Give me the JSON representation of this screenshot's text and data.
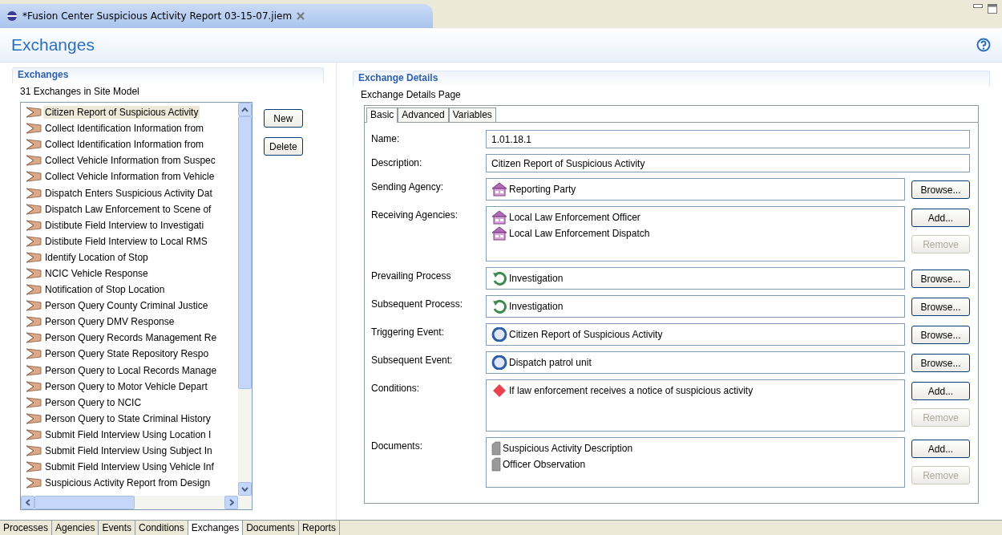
{
  "editor_tab": {
    "title": "*Fusion Center Suspicious Activity Report 03-15-07.jiem"
  },
  "page_title": "Exchanges",
  "exchanges": {
    "title": "Exchanges",
    "subtitle": "31 Exchanges in Site Model",
    "items": [
      {
        "text": "Citizen Report of Suspicious Activity",
        "selected": true
      },
      {
        "text": "Collect Identification Information from",
        "selected": false
      },
      {
        "text": "Collect Identification Information from",
        "selected": false
      },
      {
        "text": "Collect Vehicle Information from Suspec",
        "selected": false
      },
      {
        "text": "Collect Vehicle Information from Vehicle",
        "selected": false
      },
      {
        "text": "Dispatch Enters Suspicious Activity Dat",
        "selected": false
      },
      {
        "text": "Dispatch Law Enforcement to Scene of",
        "selected": false
      },
      {
        "text": "Distibute Field Interview to Investigati",
        "selected": false
      },
      {
        "text": "Distibute Field Interview to Local RMS",
        "selected": false
      },
      {
        "text": "Identify Location of Stop",
        "selected": false
      },
      {
        "text": "NCIC Vehicle Response",
        "selected": false
      },
      {
        "text": "Notification of Stop Location",
        "selected": false
      },
      {
        "text": "Person Query County Criminal Justice",
        "selected": false
      },
      {
        "text": "Person Query DMV Response",
        "selected": false
      },
      {
        "text": "Person Query Records Management Re",
        "selected": false
      },
      {
        "text": "Person Query State Repository Respo",
        "selected": false
      },
      {
        "text": "Person Query to Local Records Manage",
        "selected": false
      },
      {
        "text": "Person Query to Motor Vehicle Depart",
        "selected": false
      },
      {
        "text": "Person Query to NCIC",
        "selected": false
      },
      {
        "text": "Person Query to State Criminal History",
        "selected": false
      },
      {
        "text": "Submit Field Interview Using Location I",
        "selected": false
      },
      {
        "text": "Submit Field Interview Using Subject In",
        "selected": false
      },
      {
        "text": "Submit Field Interview Using Vehicle Inf",
        "selected": false
      },
      {
        "text": "Suspicious Activity Report from Design",
        "selected": false
      }
    ],
    "buttons": [
      "New",
      "Delete"
    ]
  },
  "detail": {
    "title": "Exchange Details",
    "subtitle": "Exchange Details Page",
    "tabs": [
      {
        "label": "Basic",
        "selected": true
      },
      {
        "label": "Advanced",
        "selected": false
      },
      {
        "label": "Variables",
        "selected": false
      }
    ],
    "fields": [
      {
        "kind": "text",
        "label": "Name:",
        "value": "1.01.18.1"
      },
      {
        "kind": "text",
        "label": "Description:",
        "value": "Citizen Report of Suspicious Activity"
      },
      {
        "kind": "single",
        "label": "Sending Agency:",
        "items": [
          {
            "kind": "agency",
            "text": "Reporting Party"
          }
        ],
        "buttons": [
          {
            "label": "Browse...",
            "disabled": false
          }
        ]
      },
      {
        "kind": "list",
        "label": "Receiving Agencies:",
        "items": [
          {
            "kind": "agency",
            "text": "Local Law Enforcement Officer"
          },
          {
            "kind": "agency",
            "text": "Local Law Enforcement Dispatch"
          }
        ],
        "buttons": [
          {
            "label": "Add...",
            "disabled": false
          },
          {
            "label": "Remove",
            "disabled": true
          }
        ]
      },
      {
        "kind": "single",
        "label": "Prevailing Process",
        "items": [
          {
            "kind": "process",
            "text": "Investigation"
          }
        ],
        "buttons": [
          {
            "label": "Browse...",
            "disabled": false
          }
        ]
      },
      {
        "kind": "single",
        "label": "Subsequent Process:",
        "items": [
          {
            "kind": "process",
            "text": "Investigation"
          }
        ],
        "buttons": [
          {
            "label": "Browse...",
            "disabled": false
          }
        ]
      },
      {
        "kind": "single",
        "label": "Triggering Event:",
        "items": [
          {
            "kind": "event",
            "text": "Citizen Report of Suspicious Activity"
          }
        ],
        "buttons": [
          {
            "label": "Browse...",
            "disabled": false
          }
        ]
      },
      {
        "kind": "single",
        "label": "Subsequent Event:",
        "items": [
          {
            "kind": "event",
            "text": "Dispatch patrol unit"
          }
        ],
        "buttons": [
          {
            "label": "Browse...",
            "disabled": false
          }
        ]
      },
      {
        "kind": "list",
        "label": "Conditions:",
        "items": [
          {
            "kind": "condition",
            "text": "If law enforcement receives a notice of suspicious activity"
          }
        ],
        "buttons": [
          {
            "label": "Add...",
            "disabled": false
          },
          {
            "label": "Remove",
            "disabled": true
          }
        ]
      },
      {
        "kind": "list",
        "label": "Documents:",
        "items": [
          {
            "kind": "document",
            "text": "Suspicious Activity Description"
          },
          {
            "kind": "document",
            "text": "Officer Observation"
          }
        ],
        "buttons": [
          {
            "label": "Add...",
            "disabled": false
          },
          {
            "label": "Remove",
            "disabled": true
          }
        ]
      }
    ]
  },
  "bottom_tabs": [
    {
      "label": "Processes",
      "selected": false
    },
    {
      "label": "Agencies",
      "selected": false
    },
    {
      "label": "Events",
      "selected": false
    },
    {
      "label": "Conditions",
      "selected": false
    },
    {
      "label": "Exchanges",
      "selected": true
    },
    {
      "label": "Documents",
      "selected": false
    },
    {
      "label": "Reports",
      "selected": false
    }
  ]
}
